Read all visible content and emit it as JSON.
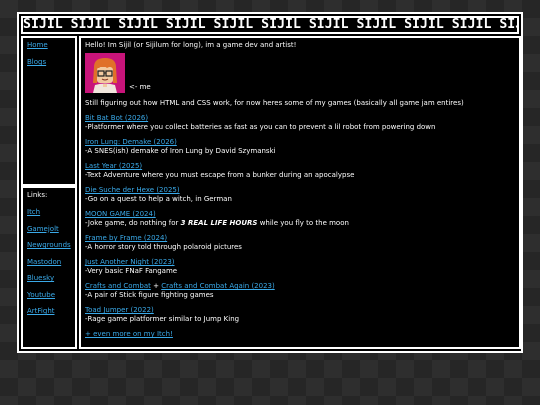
{
  "header": {
    "title": "SIJIL SIJIL SIJIL SIJIL SIJIL SIJIL SIJIL SIJIL SIJIL SIJIL SIJIL"
  },
  "nav": {
    "items": [
      {
        "label": "Home"
      },
      {
        "label": "Blogs"
      }
    ]
  },
  "links": {
    "title": "Links:",
    "items": [
      {
        "label": "Itch"
      },
      {
        "label": "Gamejolt"
      },
      {
        "label": "Newgrounds"
      },
      {
        "label": "Mastodon"
      },
      {
        "label": "Bluesky"
      },
      {
        "label": "Youtube"
      },
      {
        "label": "ArtFight"
      }
    ]
  },
  "main": {
    "intro": "Hello! Im Sijil (or Sijilum for long), im a game dev and artist!",
    "me_caption": "<- me",
    "figuring": "Still figuring out how HTML and CSS work, for now heres some of my games (basically all game jam entires)",
    "games": [
      {
        "title": "Bit Bat Bot (2026)",
        "desc": "-Platformer where you collect batteries as fast as you can to prevent a lil robot from powering down"
      },
      {
        "title": "Iron Lung: Demake (2026)",
        "desc": "-A SNES(ish) demake of Iron Lung by David Szymanski"
      },
      {
        "title": "Last Year (2025)",
        "desc": "-Text Adventure where you must escape from a bunker during an apocalypse"
      },
      {
        "title": "Die Suche der Hexe (2025)",
        "desc": "-Go on a quest to help a witch, in German"
      },
      {
        "title": "MOON GAME (2024)",
        "desc_pre": "-Joke game, do nothing for ",
        "desc_bold": "3 REAL LIFE HOURS",
        "desc_post": " while you fly to the moon"
      },
      {
        "title": "Frame by Frame (2024)",
        "desc": "-A horror story told through polaroid pictures"
      },
      {
        "title": "Just Another Night (2023)",
        "desc": "-Very basic FNaF Fangame"
      },
      {
        "title": "Crafts and Combat",
        "plus": "+",
        "title2": "Crafts and Combat Again (2023)",
        "desc": "-A pair of Stick figure fighting games"
      },
      {
        "title": "Toad Jumper (2022)",
        "desc": "-Rage game platformer similar to Jump King"
      }
    ],
    "more": "+ even more on my Itch!"
  },
  "colors": {
    "link": "#3aa9e8",
    "panel_bg": "#000000",
    "border": "#ffffff",
    "avatar_bg": "#c8147a"
  }
}
